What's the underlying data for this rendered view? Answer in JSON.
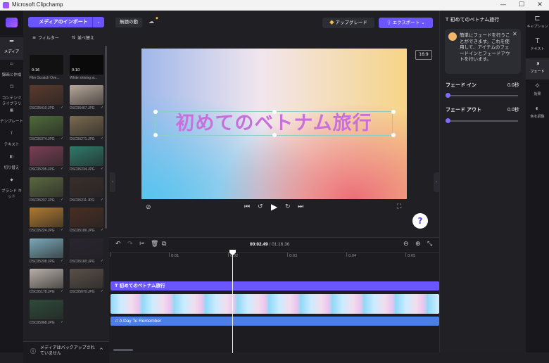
{
  "window": {
    "title": "Microsoft Clipchamp",
    "minimize": "—",
    "maximize": "☐",
    "close": "✕"
  },
  "leftnav": {
    "items": [
      {
        "label": "メディア",
        "icon": "folder-icon",
        "glyph": "▬"
      },
      {
        "label": "録画と作成",
        "icon": "camera-icon",
        "glyph": "▭"
      },
      {
        "label": "コンテンツ ライブラリ",
        "icon": "library-icon",
        "glyph": "❐"
      },
      {
        "label": "テンプレート",
        "icon": "templates-icon",
        "glyph": "▦"
      },
      {
        "label": "テキスト",
        "icon": "text-icon",
        "glyph": "T"
      },
      {
        "label": "切り替え",
        "icon": "transition-icon",
        "glyph": "◧"
      },
      {
        "label": "ブランド キット",
        "icon": "brand-icon",
        "glyph": "◆"
      }
    ]
  },
  "media": {
    "import_label": "メディアのインポート",
    "filter_label": "フィルター",
    "sort_label": "並べ替え",
    "top_items": [
      {
        "label": "Film Scratch Ove...",
        "duration": "0:16"
      },
      {
        "label": "White shining st...",
        "duration": "0:10"
      }
    ],
    "images": [
      {
        "label": "DSC05410.JPG",
        "color": "#5a3a2c"
      },
      {
        "label": "DSC05407.JPG",
        "color": "#b9a89a"
      },
      {
        "label": "DSC05374.JPG",
        "color": "#4e6a3a"
      },
      {
        "label": "DSC05271.JPG",
        "color": "#7a6a50"
      },
      {
        "label": "DSC05295.JPG",
        "color": "#7b3f55"
      },
      {
        "label": "DSC05234.JPG",
        "color": "#2e7a6a"
      },
      {
        "label": "DSC05207.JPG",
        "color": "#5a6840"
      },
      {
        "label": "DSC05211.JPG",
        "color": "#3a2e2a"
      },
      {
        "label": "DSC05224.JPG",
        "color": "#b07a30"
      },
      {
        "label": "DSC05186.JPG",
        "color": "#4a2e22"
      },
      {
        "label": "DSC05208.JPG",
        "color": "#7ba8b8"
      },
      {
        "label": "DSC05160.JPG",
        "color": "#2a2430"
      },
      {
        "label": "DSC05178.JPG",
        "color": "#b8b0a8"
      },
      {
        "label": "DSC05070.JPG",
        "color": "#5a5048"
      },
      {
        "label": "DSC05068.JPG",
        "color": "#2e4a3a"
      }
    ],
    "backup_text": "メディアはバックアップされていません"
  },
  "toolbar": {
    "project_name": "無題の動画",
    "upgrade_label": "アップグレード",
    "export_label": "エクスポート"
  },
  "preview": {
    "overlay_text": "初めてのベトナム旅行",
    "aspect_ratio": "16:9"
  },
  "timeline": {
    "current_time": "00:02.49",
    "total_time": "01:16.36",
    "ticks": [
      "0",
      "0:01",
      "0:02",
      "0:03",
      "0:04",
      "0:05"
    ],
    "text_track_label": "初めてのベトナム旅行",
    "audio_track_label": "A Day To Remember"
  },
  "rightpanel": {
    "header": "初めてのベトナム旅行",
    "tip": "簡単にフェードを行うことができます。これを使用して、アイテムのフェードインとフェードアウトを行います。",
    "fade_in_label": "フェード イン",
    "fade_in_value": "0.0秒",
    "fade_in_fraction": 0,
    "fade_out_label": "フェード アウト",
    "fade_out_value": "0.0秒",
    "fade_out_fraction": 0
  },
  "rightrail": {
    "items": [
      {
        "label": "キャプション",
        "icon": "captions-icon",
        "glyph": "⊏"
      },
      {
        "label": "テキスト",
        "icon": "text-icon",
        "glyph": "T"
      },
      {
        "label": "フェード",
        "icon": "fade-icon",
        "glyph": "◑"
      },
      {
        "label": "効果",
        "icon": "effects-icon",
        "glyph": "✧"
      },
      {
        "label": "色を調整",
        "icon": "color-adjust-icon",
        "glyph": "◐"
      }
    ]
  },
  "help": {
    "label": "?"
  }
}
